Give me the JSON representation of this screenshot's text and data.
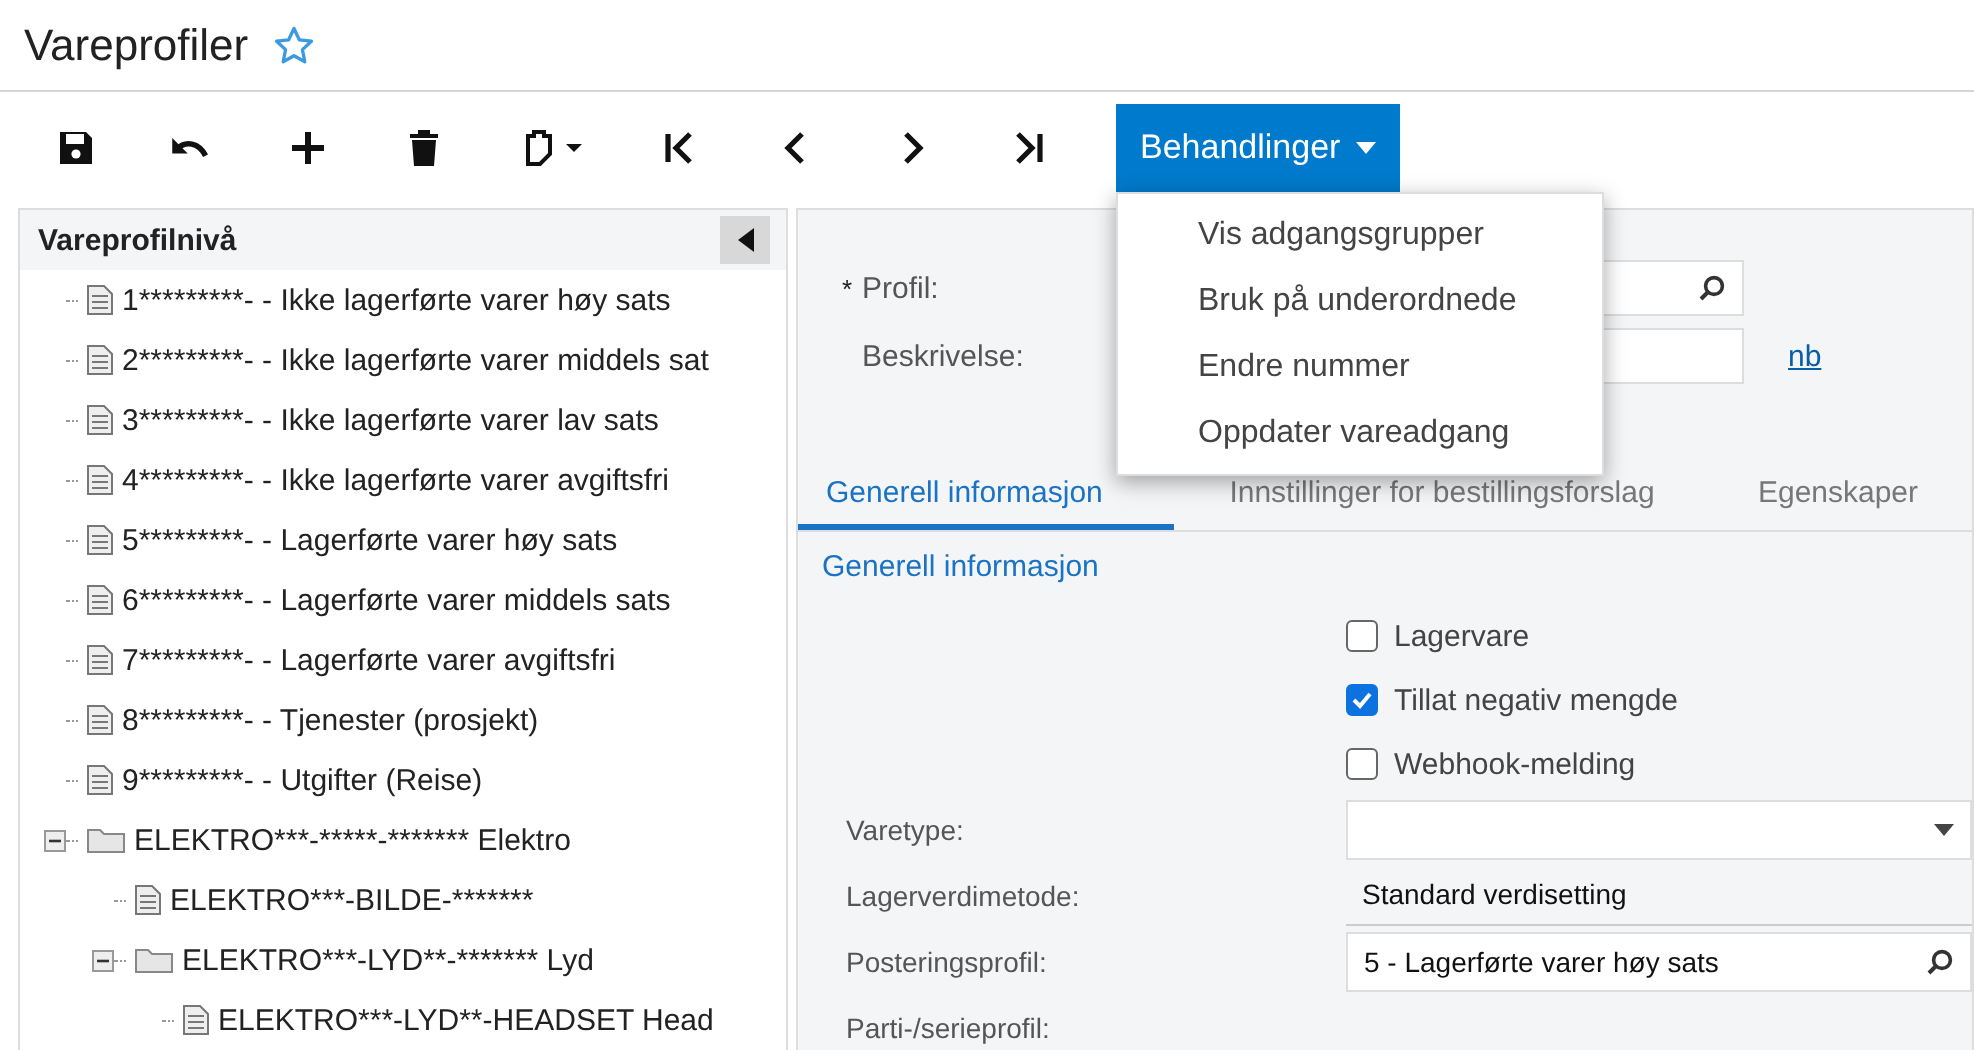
{
  "page": {
    "title": "Vareprofiler",
    "favorite": false
  },
  "actions_menu": {
    "label": "Behandlinger",
    "expanded": true,
    "items": [
      "Vis adgangsgrupper",
      "Bruk på underordnede",
      "Endre nummer",
      "Oppdater vareadgang"
    ]
  },
  "tree": {
    "title": "Vareprofilnivå",
    "items": [
      {
        "kind": "doc",
        "label": "1*********- - Ikke lagerførte varer høy sats"
      },
      {
        "kind": "doc",
        "label": "2*********- - Ikke lagerførte varer middels sat"
      },
      {
        "kind": "doc",
        "label": "3*********- - Ikke lagerførte varer lav sats"
      },
      {
        "kind": "doc",
        "label": "4*********- - Ikke lagerførte varer avgiftsfri"
      },
      {
        "kind": "doc",
        "label": "5*********- - Lagerførte varer høy sats"
      },
      {
        "kind": "doc",
        "label": "6*********- - Lagerførte varer middels sats"
      },
      {
        "kind": "doc",
        "label": "7*********- - Lagerførte varer avgiftsfri"
      },
      {
        "kind": "doc",
        "label": "8*********- - Tjenester (prosjekt)"
      },
      {
        "kind": "doc",
        "label": "9*********- - Utgifter (Reise)"
      },
      {
        "kind": "folder",
        "label": "ELEKTRO***-*****-******* Elektro",
        "expanded": true,
        "children": [
          {
            "kind": "doc",
            "label": "ELEKTRO***-BILDE-*******"
          },
          {
            "kind": "folder",
            "label": "ELEKTRO***-LYD**-******* Lyd",
            "expanded": true,
            "children": [
              {
                "kind": "doc",
                "label": "ELEKTRO***-LYD**-HEADSET Head"
              }
            ]
          }
        ]
      }
    ]
  },
  "header_form": {
    "profile_required": true,
    "required_mark": "*",
    "profile_label": "Profil:",
    "description_label": "Beskrivelse:",
    "language_link": "nb"
  },
  "tabs": [
    {
      "label": "Generell informasjon",
      "selected": true
    },
    {
      "label": "Innstillinger for bestillingsforslag",
      "selected": false
    },
    {
      "label": "Egenskaper",
      "selected": false
    }
  ],
  "section": {
    "title": "Generell informasjon",
    "checkboxes": [
      {
        "label": "Lagervare",
        "checked": false
      },
      {
        "label": "Tillat negativ mengde",
        "checked": true
      },
      {
        "label": "Webhook-melding",
        "checked": false
      }
    ],
    "fields": [
      {
        "kind": "dropdown",
        "label": "Varetype:"
      },
      {
        "kind": "static",
        "label": "Lagerverdimetode:",
        "value": "Standard verdisetting"
      },
      {
        "kind": "lookup",
        "label": "Posteringsprofil:",
        "value": "5 - Lagerførte varer høy sats"
      },
      {
        "kind": "label",
        "label": "Parti-/serieprofil:"
      }
    ]
  }
}
